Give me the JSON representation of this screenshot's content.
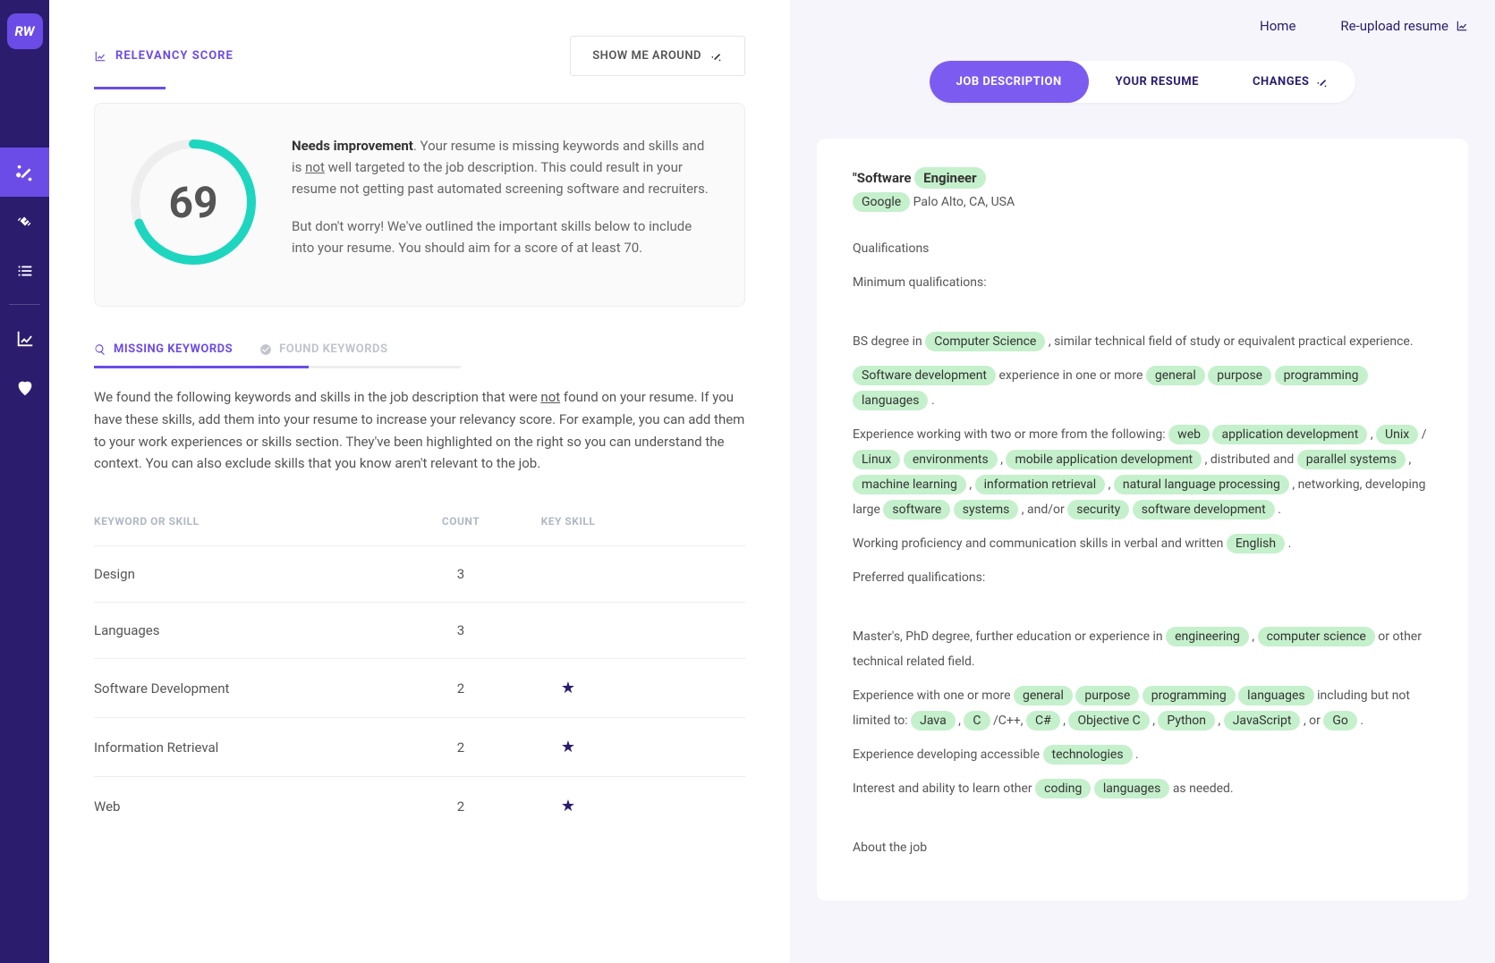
{
  "logo": "RW",
  "header": {
    "section_title": "RELEVANCY SCORE",
    "tour_btn": "SHOW ME AROUND"
  },
  "score": {
    "value": "69",
    "headline": "Needs improvement",
    "para1_after_bold": ". Your resume is missing keywords and skills and is ",
    "para1_underline": "not",
    "para1_end": " well targeted to the job description. This could result in your resume not getting past automated screening software and recruiters.",
    "para2": "But don't worry! We've outlined the important skills below to include into your resume. You should aim for a score of at least 70."
  },
  "kw_tabs": {
    "missing": "MISSING KEYWORDS",
    "found": "FOUND KEYWORDS"
  },
  "kw_desc": {
    "pre": "We found the following keywords and skills in the job description that were ",
    "underline": "not",
    "post": " found on your resume. If you have these skills, add them into your resume to increase your relevancy score. For example, you can add them to your work experiences or skills section. They've been highlighted on the right so you can understand the context. You can also exclude skills that you know aren't relevant to the job."
  },
  "table": {
    "h1": "KEYWORD OR SKILL",
    "h2": "COUNT",
    "h3": "KEY SKILL",
    "rows": [
      {
        "kw": "Design",
        "count": "3",
        "key": false
      },
      {
        "kw": "Languages",
        "count": "3",
        "key": false
      },
      {
        "kw": "Software Development",
        "count": "2",
        "key": true
      },
      {
        "kw": "Information Retrieval",
        "count": "2",
        "key": true
      },
      {
        "kw": "Web",
        "count": "2",
        "key": true
      }
    ]
  },
  "top_links": {
    "home": "Home",
    "reupload": "Re-upload resume"
  },
  "pills": {
    "jd": "JOB DESCRIPTION",
    "resume": "YOUR RESUME",
    "changes": "CHANGES"
  },
  "jd": {
    "title_pre": "\"Software ",
    "title_hl": "Engineer",
    "company_hl": "Google",
    "location": " Palo Alto, CA, USA",
    "qual_h": "Qualifications",
    "min_q": "Minimum qualifications:",
    "p1_pre": "BS degree in ",
    "p1_hl": "Computer  Science",
    "p1_post": " , similar technical field of study or equivalent practical experience.",
    "p2_hl1": "Software  development",
    "p2_t1": " experience in one or more ",
    "p2_hl2": "general",
    "p2_hl3": "purpose",
    "p2_hl4": "programming",
    "p2_hl5": "languages",
    "p2_end": " .",
    "p3_t1": "Experience working with two or more from the following: ",
    "p3_hl1": "web",
    "p3_hl2": "application  development",
    "p3_t2": " , ",
    "p3_hl3": "Unix",
    "p3_t3": " / ",
    "p3_hl4": "Linux",
    "p3_hl5": "environments",
    "p3_t4": " , ",
    "p3_hl6": "mobile  application  development",
    "p3_t5": " , distributed and ",
    "p3_hl7": "parallel  systems",
    "p3_t6": " , ",
    "p3_hl8": "machine  learning",
    "p3_t7": " , ",
    "p3_hl9": "information  retrieval",
    "p3_t8": " , ",
    "p3_hl10": "natural  language  processing",
    "p3_t9": " , networking, developing large ",
    "p3_hl11": "software",
    "p3_hl12": "systems",
    "p3_t10": " , and/or ",
    "p3_hl13": "security",
    "p3_hl14": "software  development",
    "p3_t11": " .",
    "p4_t1": "Working proficiency and communication skills in verbal and written ",
    "p4_hl1": "English",
    "p4_t2": " .",
    "pref_q": "Preferred qualifications:",
    "p5_t1": "Master's, PhD degree, further education or experience in ",
    "p5_hl1": "engineering",
    "p5_t2": " , ",
    "p5_hl2": "computer  science",
    "p5_t3": " or other technical related field.",
    "p6_t1": "Experience with one or more ",
    "p6_hl1": "general",
    "p6_hl2": "purpose",
    "p6_hl3": "programming",
    "p6_hl4": "languages",
    "p6_t2": " including but not limited to: ",
    "p6_hl5": "Java",
    "p6_t3": " , ",
    "p6_hl6": "C",
    "p6_t4": " /C++, ",
    "p6_hl7": "C#",
    "p6_t5": " , ",
    "p6_hl8": "Objective  C",
    "p6_t6": " , ",
    "p6_hl9": "Python",
    "p6_t7": " , ",
    "p6_hl10": "JavaScript",
    "p6_t8": " , or ",
    "p6_hl11": "Go",
    "p6_t9": " .",
    "p7_t1": "Experience developing accessible ",
    "p7_hl1": "technologies",
    "p7_t2": " .",
    "p8_t1": "Interest and ability to learn other ",
    "p8_hl1": "coding",
    "p8_hl2": "languages",
    "p8_t2": " as needed.",
    "about": "About the job"
  }
}
